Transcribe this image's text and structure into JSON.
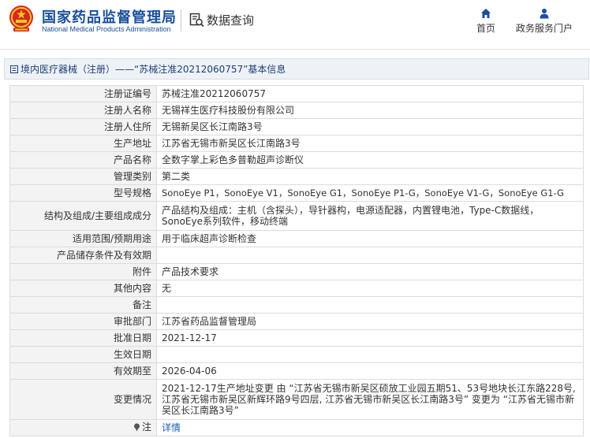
{
  "header": {
    "org_name_cn": "国家药品监督管理局",
    "org_name_en": "National Medical Products Administration",
    "db_title": "数据查询",
    "nav": [
      {
        "label": "首页",
        "icon": "home-icon"
      },
      {
        "label": "政务服务门户",
        "icon": "user-icon"
      }
    ]
  },
  "breadcrumb": {
    "text": "境内医疗器械（注册）——“苏械注准20212060757”基本信息"
  },
  "details": {
    "rows": [
      {
        "key": "注册证编号",
        "value": "苏械注准20212060757"
      },
      {
        "key": "注册人名称",
        "value": "无锡祥生医疗科技股份有限公司"
      },
      {
        "key": "注册人住所",
        "value": "无锡新吴区长江南路3号"
      },
      {
        "key": "生产地址",
        "value": "江苏省无锡市新吴区长江南路3号"
      },
      {
        "key": "产品名称",
        "value": "全数字掌上彩色多普勒超声诊断仪"
      },
      {
        "key": "管理类别",
        "value": "第二类"
      },
      {
        "key": "型号规格",
        "value": "SonoEye P1，SonoEye V1，SonoEye G1，SonoEye P1-G，SonoEye V1-G，SonoEye G1-G"
      },
      {
        "key": "结构及组成/主要组成成分",
        "value": "产品结构及组成：主机（含探头），导针器构，电源适配器，内置锂电池，Type-C数据线，SonoEye系列软件，移动终端"
      },
      {
        "key": "适用范围/预期用途",
        "value": "用于临床超声诊断检查"
      },
      {
        "key": "产品储存条件及有效期",
        "value": ""
      },
      {
        "key": "附件",
        "value": "产品技术要求"
      },
      {
        "key": "其他内容",
        "value": "无"
      },
      {
        "key": "备注",
        "value": ""
      },
      {
        "key": "审批部门",
        "value": "江苏省药品监督管理局"
      },
      {
        "key": "批准日期",
        "value": "2021-12-17"
      },
      {
        "key": "生效日期",
        "value": ""
      },
      {
        "key": "有效期至",
        "value": "2026-04-06"
      },
      {
        "key": "变更情况",
        "value": "2021-12-17生产地址变更 由 “江苏省无锡市新吴区硕放工业园五期51、53号地块长江东路228号, 江苏省无锡市新吴区新辉环路9号四层, 江苏省无锡市新吴区长江南路3号” 变更为 “江苏省无锡市新吴区长江南路3号”"
      },
      {
        "key": "注",
        "value": "详情"
      }
    ]
  },
  "colors": {
    "brand_blue": "#1a4f9c",
    "emblem_red": "#d7261e",
    "emblem_gold": "#f3c623",
    "label_bg": "#f3f3f3",
    "link": "#1a5fb4"
  }
}
